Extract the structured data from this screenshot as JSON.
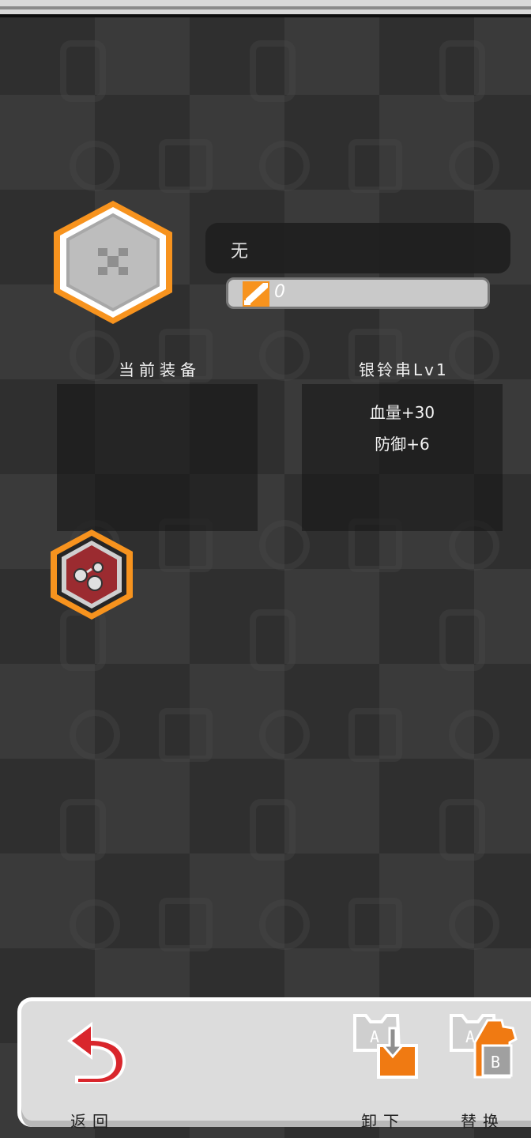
{
  "equip": {
    "name": "无",
    "power": "0"
  },
  "current_section": {
    "label": "当前装备",
    "stats": []
  },
  "candidate_section": {
    "label": "银铃串Lv1",
    "stats": [
      "血量+30",
      "防御+6"
    ]
  },
  "actions": {
    "back": "返回",
    "unequip": "卸下",
    "replace": "替换"
  },
  "colors": {
    "accent_orange": "#f7931e",
    "item_red": "#9b2b30",
    "back_red": "#d9262c"
  },
  "icons": {
    "empty_slot": "crossed-swords-icon",
    "candidate_item": "bell-string-icon",
    "back": "return-arrow-icon",
    "unequip": "unequip-armor-icon",
    "replace": "swap-armor-icon"
  }
}
